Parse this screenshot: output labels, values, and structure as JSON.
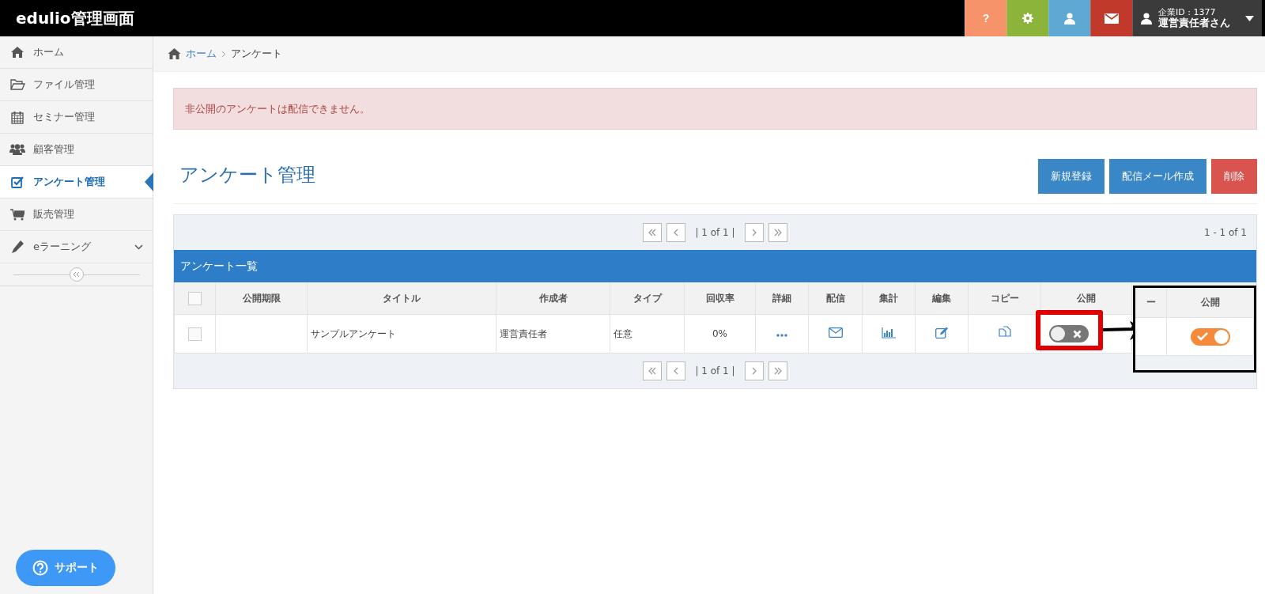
{
  "app_title": "edulio管理画面",
  "header": {
    "buttons": [
      {
        "kind": "help",
        "label": "?"
      },
      {
        "kind": "settings"
      },
      {
        "kind": "profile"
      },
      {
        "kind": "mail"
      }
    ],
    "user": {
      "company_id": "企業ID : 1377",
      "name": "運営責任者さん"
    }
  },
  "sidebar": {
    "items": [
      {
        "label": "ホーム",
        "selected": false,
        "has_submenu": false
      },
      {
        "label": "ファイル管理",
        "selected": false,
        "has_submenu": false
      },
      {
        "label": "セミナー管理",
        "selected": false,
        "has_submenu": false
      },
      {
        "label": "顧客管理",
        "selected": false,
        "has_submenu": false
      },
      {
        "label": "アンケート管理",
        "selected": true,
        "has_submenu": false
      },
      {
        "label": "販売管理",
        "selected": false,
        "has_submenu": false
      },
      {
        "label": "eラーニング",
        "selected": false,
        "has_submenu": true
      }
    ],
    "support_button": "サポート"
  },
  "breadcrumb": [
    "ホーム",
    "アンケート"
  ],
  "alert": "非公開のアンケートは配信できません。",
  "page_title": "アンケート管理",
  "actions": [
    {
      "label": "新規登録",
      "kind": "primary"
    },
    {
      "label": "配信メール作成",
      "kind": "primary"
    },
    {
      "label": "削除",
      "kind": "danger"
    }
  ],
  "top_pager": {
    "page_info": "| 1 of 1 |",
    "range": "1 - 1 of 1"
  },
  "table": {
    "title": "アンケート一覧",
    "select_all_checked": false,
    "columns": [
      "公開期限",
      "タイトル",
      "作成者",
      "タイプ",
      "回収率",
      "詳細",
      "配信",
      "集計",
      "編集",
      "コピー",
      "公開"
    ],
    "rows": [
      {
        "checked": false,
        "title": "サンプルアンケート",
        "author": "運営責任者",
        "type": "任意",
        "response_rate": "0%",
        "published": false
      }
    ]
  },
  "bottom_pager": {
    "page_info": "| 1 of 1 |"
  },
  "annotation": {
    "inset": {
      "columns": [
        "ー",
        "公開"
      ],
      "published": true
    }
  }
}
